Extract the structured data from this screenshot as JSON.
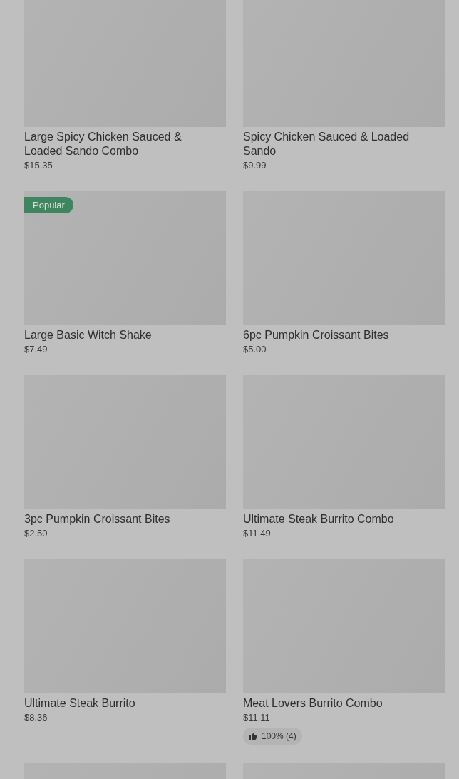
{
  "items": [
    {
      "kind": "product",
      "title": "Large Spicy Chicken Sauced & Loaded Sando Combo",
      "price": "$15.35"
    },
    {
      "kind": "product",
      "title": "Spicy Chicken Sauced & Loaded Sando",
      "price": "$9.99"
    },
    {
      "kind": "product",
      "title": "Large Basic Witch Shake",
      "price": "$7.49",
      "badge": "Popular"
    },
    {
      "kind": "product",
      "title": "6pc Pumpkin Croissant Bites",
      "price": "$5.00"
    },
    {
      "kind": "product",
      "title": "3pc Pumpkin Croissant Bites",
      "price": "$2.50"
    },
    {
      "kind": "product",
      "title": "Ultimate Steak Burrito Combo",
      "price": "$11.49"
    },
    {
      "kind": "product",
      "title": "Ultimate Steak Burrito",
      "price": "$8.36"
    },
    {
      "kind": "product",
      "title": "Meat Lovers Burrito Combo",
      "price": "$11.11",
      "rating": "100% (4)"
    },
    {
      "kind": "image-only"
    },
    {
      "kind": "image-only"
    }
  ]
}
